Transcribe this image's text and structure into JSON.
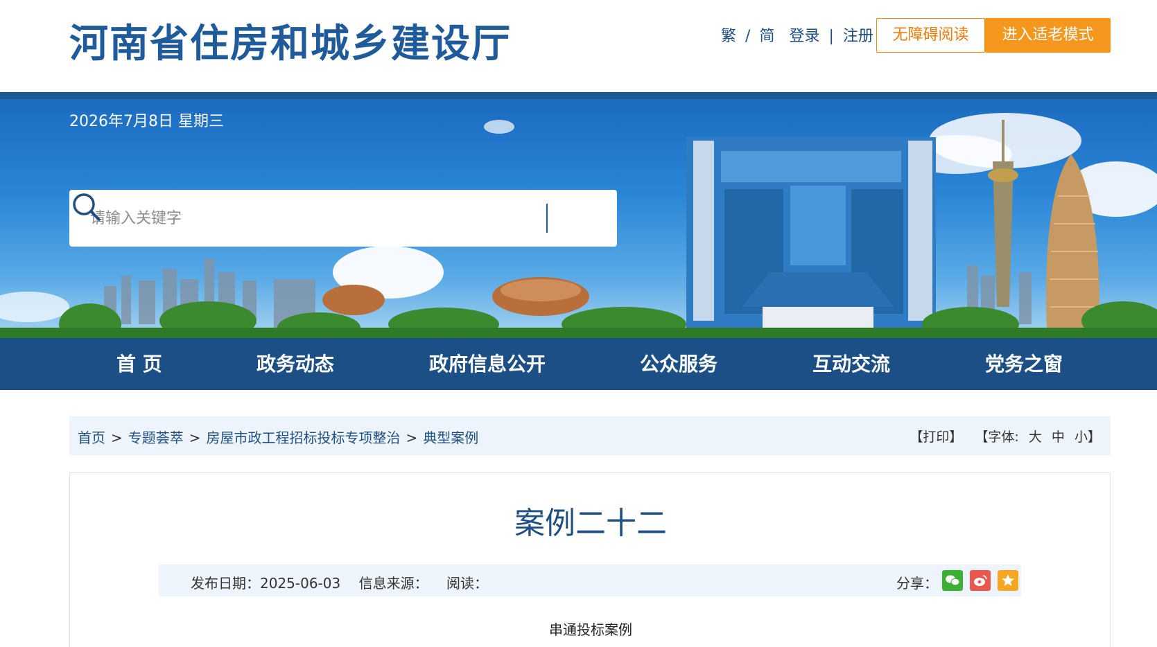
{
  "header": {
    "site_title": "河南省住房和城乡建设厅",
    "lang_trad": "繁",
    "lang_sep": "/",
    "lang_simp": "简",
    "login": "登录",
    "link_sep": "|",
    "register": "注册",
    "accessible_reading": "无障碍阅读",
    "elderly_mode": "进入适老模式"
  },
  "banner": {
    "date": "2026年7月8日 星期三"
  },
  "search": {
    "placeholder": "请输入关键字"
  },
  "nav": {
    "items": [
      "首 页",
      "政务动态",
      "政府信息公开",
      "公众服务",
      "互动交流",
      "党务之窗"
    ]
  },
  "breadcrumb": {
    "items": [
      "首页",
      "专题荟萃",
      "房屋市政工程招标投标专项整治",
      "典型案例"
    ],
    "separator": ">",
    "print": "【打印】",
    "font_label": "【字体:",
    "font_large": "大",
    "font_medium": "中",
    "font_small": "小】"
  },
  "article": {
    "title": "案例二十二",
    "publish_date": "发布日期：2025-06-03",
    "source": "信息来源：",
    "reads": "阅读：",
    "share_label": "分享：",
    "subtitle": "串通投标案例"
  },
  "colors": {
    "brand_blue": "#1b4f86",
    "accent_orange": "#f5961d"
  },
  "icons": {
    "search": "search-icon",
    "wechat": "wechat-icon",
    "weibo": "weibo-icon",
    "favorite": "star-icon"
  }
}
